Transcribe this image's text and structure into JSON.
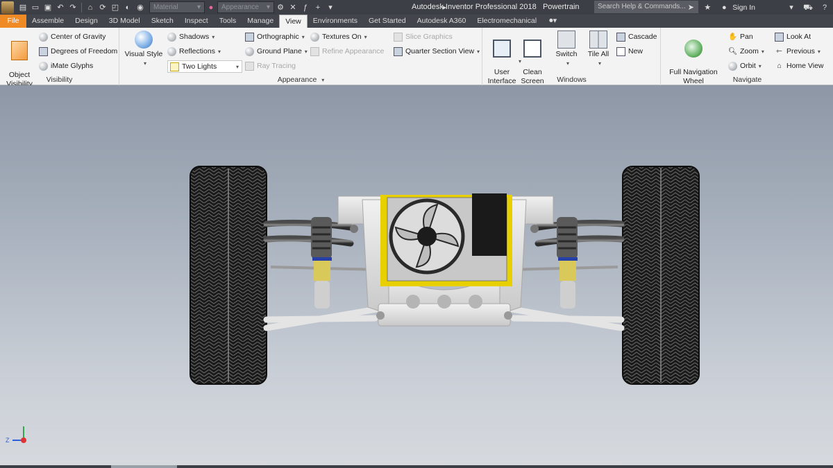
{
  "titlebar": {
    "title": "Autodesk Inventor Professional 2018",
    "document": "Powertrain",
    "material_select": "Material",
    "appearance_select": "Appearance",
    "search_placeholder": "Search Help & Commands...",
    "sign_in": "Sign In"
  },
  "tabs": [
    {
      "label": "File"
    },
    {
      "label": "Assemble"
    },
    {
      "label": "Design"
    },
    {
      "label": "3D Model"
    },
    {
      "label": "Sketch"
    },
    {
      "label": "Inspect"
    },
    {
      "label": "Tools"
    },
    {
      "label": "Manage"
    },
    {
      "label": "View"
    },
    {
      "label": "Environments"
    },
    {
      "label": "Get Started"
    },
    {
      "label": "Autodesk A360"
    },
    {
      "label": "Electromechanical"
    }
  ],
  "visibility": {
    "object_visibility": "Object\nVisibility",
    "center_of_gravity": "Center of Gravity",
    "degrees_of_freedom": "Degrees of Freedom",
    "imate_glyphs": "iMate Glyphs",
    "label": "Visibility"
  },
  "appearance": {
    "visual_style": "Visual Style",
    "shadows": "Shadows",
    "reflections": "Reflections",
    "lighting": "Two Lights",
    "orthographic": "Orthographic",
    "ground_plane": "Ground Plane",
    "ray_tracing": "Ray Tracing",
    "textures_on": "Textures On",
    "refine_appearance": "Refine Appearance",
    "slice_graphics": "Slice Graphics",
    "quarter_section_view": "Quarter Section View",
    "label": "Appearance"
  },
  "windows": {
    "user_interface": "User\nInterface",
    "clean_screen": "Clean\nScreen",
    "switch": "Switch",
    "tile_all": "Tile All",
    "cascade": "Cascade",
    "new": "New",
    "label": "Windows"
  },
  "navigate": {
    "full_navigation_wheel": "Full Navigation\nWheel",
    "pan": "Pan",
    "zoom": "Zoom",
    "orbit": "Orbit",
    "look_at": "Look At",
    "previous": "Previous",
    "home_view": "Home View",
    "label": "Navigate"
  },
  "viewport": {
    "model": "front-suspension-powertrain-assembly",
    "triad_z": "Z"
  },
  "colors": {
    "file_tab": "#f08a24",
    "titlebar": "#3c3f45",
    "ribbon": "#f3f3f3",
    "frame": "#e9e9e9",
    "tire": "#1b1b1b",
    "accent_yellow": "#e8d000"
  }
}
